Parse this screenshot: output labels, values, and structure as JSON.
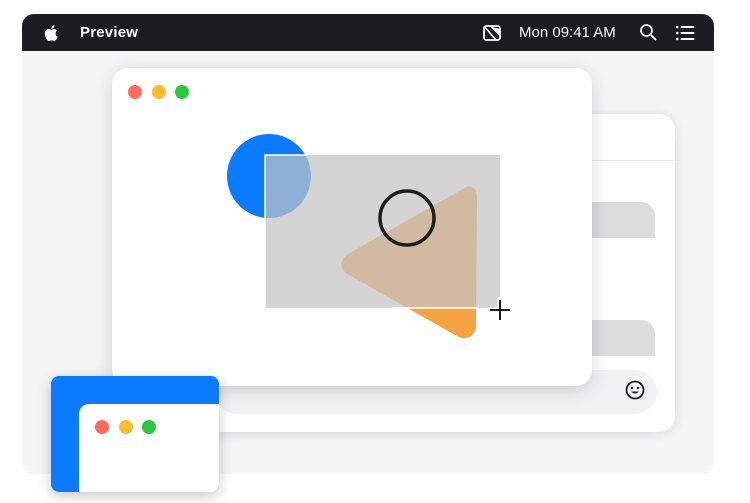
{
  "menubar": {
    "app_name": "Preview",
    "clock": "Mon 09:41 AM",
    "icons": [
      "apple-logo-icon",
      "control-center-icon",
      "search-icon",
      "list-icon"
    ]
  },
  "colors": {
    "menubar_bg": "#1d1d1f",
    "window_close": "#ff6b5c",
    "window_minimize": "#fdbc2e",
    "window_zoom": "#28c840",
    "accent_blue": "#0a7bff",
    "accent_orange": "#f4a340",
    "selection_fill": "#c8c8c8"
  },
  "main_window": {
    "content": [
      "blue-circle-shape",
      "orange-triangle-shape",
      "outlined-circle-shape",
      "screenshot-selection-rectangle"
    ]
  },
  "cursor": "crosshair-icon",
  "back_window": {
    "icons": [
      "emoji-icon"
    ]
  }
}
